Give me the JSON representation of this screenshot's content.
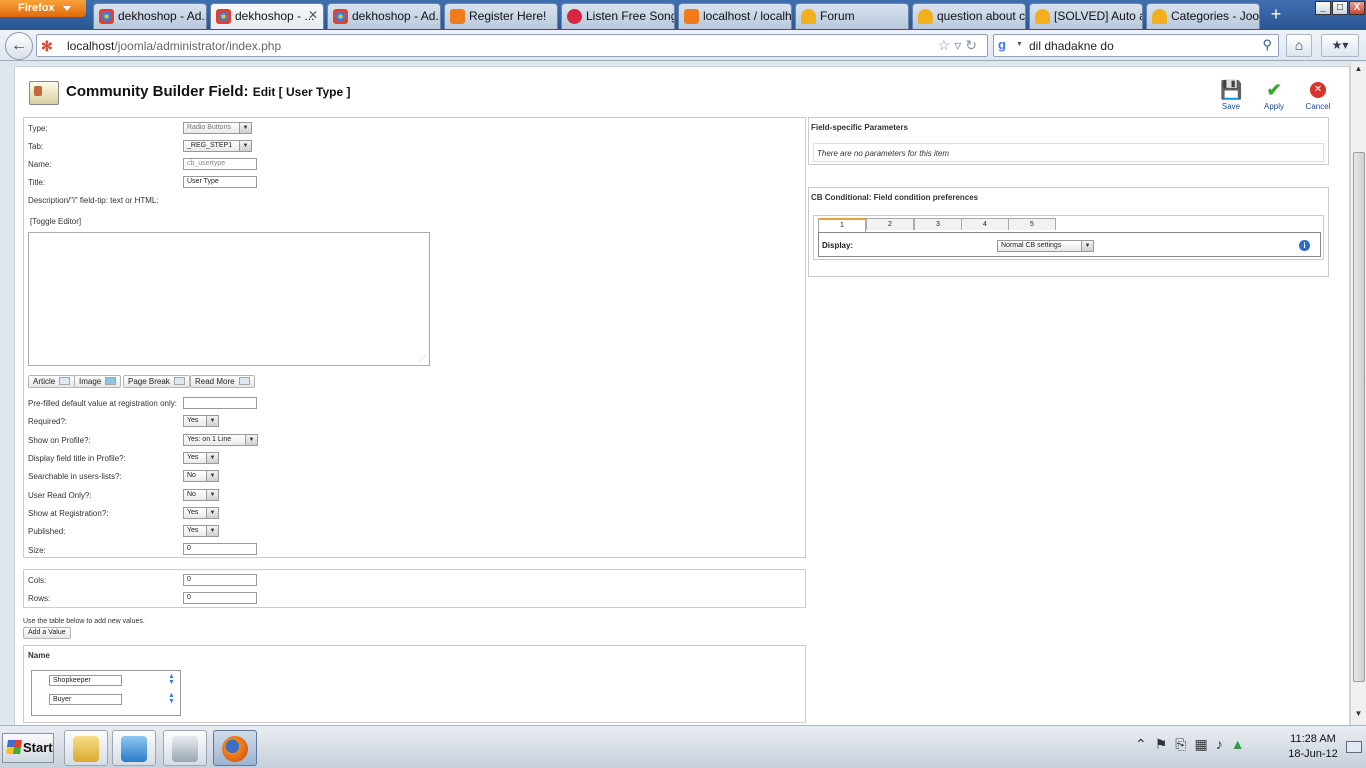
{
  "browser": {
    "menu_label": "Firefox",
    "tabs": [
      {
        "label": "dekhoshop - Ad...",
        "icon": "joomla-icon",
        "color": "#3b7ed9"
      },
      {
        "label": "dekhoshop - ...",
        "icon": "joomla-icon",
        "color": "#3b7ed9",
        "active": true
      },
      {
        "label": "dekhoshop - Ad...",
        "icon": "joomla-icon",
        "color": "#3b7ed9"
      },
      {
        "label": "Register Here!",
        "icon": "xampp-icon",
        "color": "#f07b1d"
      },
      {
        "label": "Listen Free Song...",
        "icon": "in-music-icon",
        "color": "#d7263d"
      },
      {
        "label": "localhost / localh...",
        "icon": "xampp-icon",
        "color": "#f07b1d"
      },
      {
        "label": "Forum",
        "icon": "hardhat-icon",
        "color": "#f2b01e"
      },
      {
        "label": "question about c...",
        "icon": "hardhat-icon",
        "color": "#f2b01e"
      },
      {
        "label": "[SOLVED] Auto a...",
        "icon": "hardhat-icon",
        "color": "#f2b01e"
      },
      {
        "label": "Categories - Joo...",
        "icon": "hardhat-icon",
        "color": "#f2b01e"
      }
    ],
    "url_host": "localhost",
    "url_path": "/joomla/administrator/index.php",
    "search_query": "dil dhadakne do",
    "window_controls": [
      "_",
      "□",
      "X"
    ]
  },
  "page": {
    "title": "Community Builder Field:",
    "subtitle": "Edit [ User Type ]",
    "toolbar": {
      "save": "Save",
      "apply": "Apply",
      "cancel": "Cancel"
    },
    "form": {
      "type_label": "Type:",
      "type_value": "Radio Buttons",
      "tab_label": "Tab:",
      "tab_value": "_REG_STEP1",
      "name_label": "Name:",
      "name_value": "cb_usertype",
      "title_label": "Title:",
      "title_value": "User Type",
      "description_label": "Description/\"i\" field-tip: text or HTML:",
      "toggle_editor": "[Toggle Editor]",
      "editor_buttons": [
        "Article",
        "Image",
        "Page Break",
        "Read More"
      ],
      "prefilled_label": "Pre-filled default value at registration only:",
      "prefilled_value": "",
      "required_label": "Required?:",
      "required_value": "Yes",
      "show_profile_label": "Show on Profile?:",
      "show_profile_value": "Yes: on 1 Line",
      "display_title_label": "Display field title in Profile?:",
      "display_title_value": "Yes",
      "searchable_label": "Searchable in users-lists?:",
      "searchable_value": "No",
      "readonly_label": "User Read Only?:",
      "readonly_value": "No",
      "show_reg_label": "Show at Registration?:",
      "show_reg_value": "Yes",
      "published_label": "Published:",
      "published_value": "Yes",
      "size_label": "Size:",
      "size_value": "0",
      "cols_label": "Cols:",
      "cols_value": "0",
      "rows_label": "Rows:",
      "rows_value": "0",
      "values_hint": "Use the table below to add new values.",
      "add_value_button": "Add a Value",
      "values_header": "Name",
      "values": [
        "Shopkeeper",
        "Buyer"
      ]
    },
    "field_params": {
      "title": "Field-specific Parameters",
      "empty_message": "There are no parameters for this item"
    },
    "cb_conditional": {
      "title": "CB Conditional: Field condition preferences",
      "tabs": [
        "1",
        "2",
        "3",
        "4",
        "5"
      ],
      "display_label": "Display:",
      "display_value": "Normal CB settings"
    }
  },
  "taskbar": {
    "start_label": "Start",
    "time": "11:28 AM",
    "date": "18-Jun-12"
  }
}
